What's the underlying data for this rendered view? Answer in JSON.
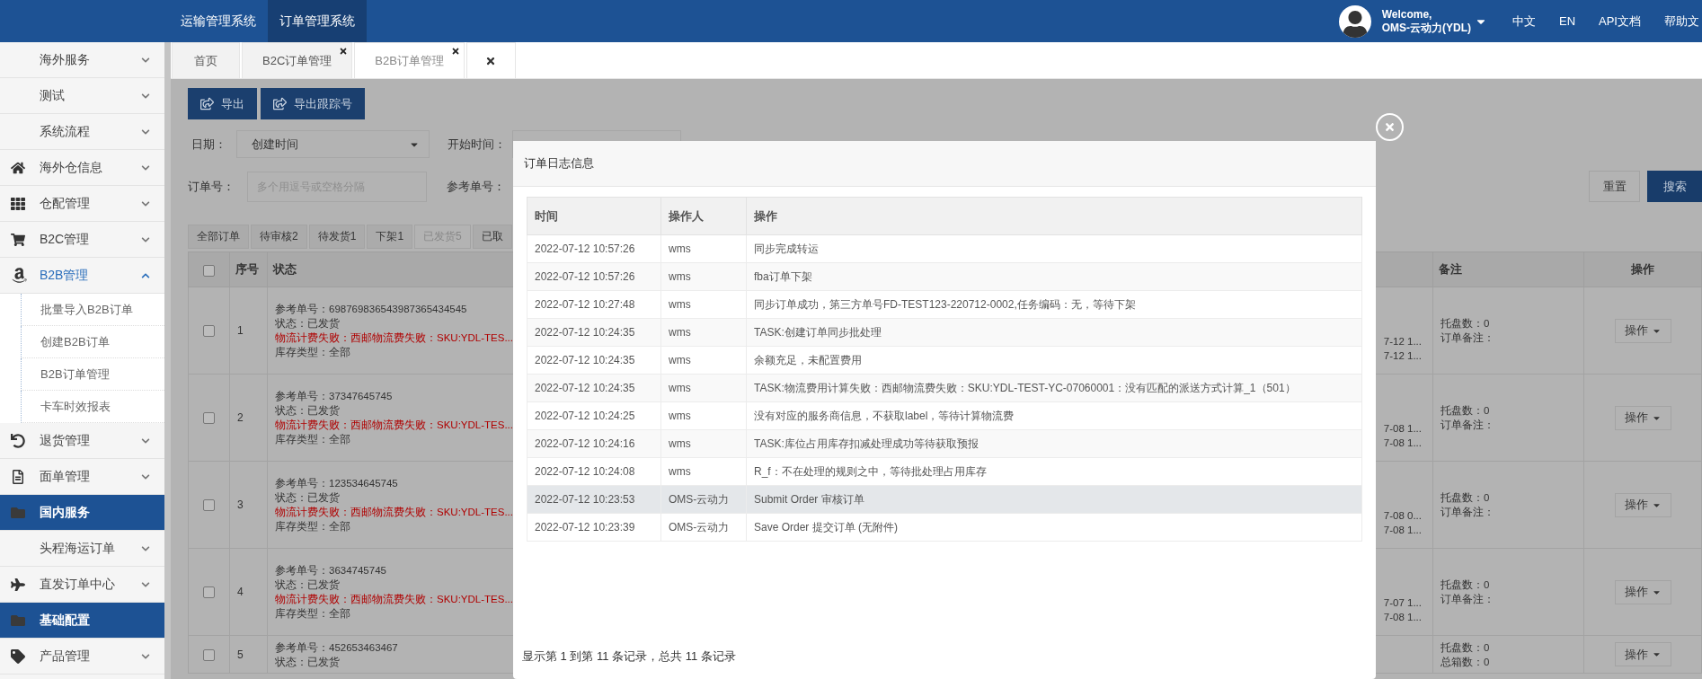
{
  "top_bar": {
    "systems": [
      {
        "label": "运输管理系统",
        "selected": false
      },
      {
        "label": "订单管理系统",
        "selected": true
      }
    ],
    "user": {
      "greeting": "Welcome,",
      "name": "OMS-云动力(YDL)"
    },
    "links": [
      "中文",
      "EN",
      "API文档",
      "帮助文"
    ]
  },
  "sidebar": {
    "items": [
      {
        "label": "海外服务",
        "kind": "menu",
        "expanded": false
      },
      {
        "label": "测试",
        "kind": "menu",
        "expanded": false
      },
      {
        "label": "系统流程",
        "kind": "menu",
        "expanded": false
      },
      {
        "label": "海外仓信息",
        "kind": "menu",
        "expanded": false
      },
      {
        "label": "仓配管理",
        "kind": "menu",
        "expanded": false
      },
      {
        "label": "B2C管理",
        "kind": "menu",
        "expanded": false
      },
      {
        "label": "B2B管理",
        "kind": "menu",
        "expanded": true,
        "children": [
          {
            "label": "批量导入B2B订单"
          },
          {
            "label": "创建B2B订单"
          },
          {
            "label": "B2B订单管理"
          },
          {
            "label": "卡车时效报表"
          }
        ]
      },
      {
        "label": "退货管理",
        "kind": "menu",
        "expanded": false
      },
      {
        "label": "面单管理",
        "kind": "menu",
        "expanded": false
      },
      {
        "label": "国内服务",
        "kind": "group"
      },
      {
        "label": "头程海运订单",
        "kind": "menu",
        "expanded": false
      },
      {
        "label": "直发订单中心",
        "kind": "menu",
        "expanded": false
      },
      {
        "label": "基础配置",
        "kind": "group"
      },
      {
        "label": "产品管理",
        "kind": "menu",
        "expanded": false
      }
    ]
  },
  "page_tabs": {
    "tabs": [
      {
        "label": "首页",
        "closable": false,
        "selected": false
      },
      {
        "label": "B2C订单管理",
        "closable": true,
        "selected": false
      },
      {
        "label": "B2B订单管理",
        "closable": true,
        "selected": true
      }
    ],
    "close_all": true
  },
  "toolbar": {
    "buttons": [
      "导出",
      "导出跟踪号"
    ]
  },
  "filters": {
    "date_label": "日期：",
    "date_value": "创建时间",
    "start_label": "开始时间：",
    "order_label": "订单号：",
    "order_placeholder": "多个用逗号或空格分隔",
    "ref_label": "参考单号：",
    "actions": [
      {
        "label": "重置",
        "primary": false
      },
      {
        "label": "搜索",
        "primary": true
      }
    ]
  },
  "status_tabs": [
    {
      "label": "全部订单",
      "selected": false
    },
    {
      "label": "待审核2",
      "selected": false
    },
    {
      "label": "待发货1",
      "selected": false
    },
    {
      "label": "下架1",
      "selected": false
    },
    {
      "label": "已发货5",
      "selected": true
    },
    {
      "label": "已取",
      "selected": false
    }
  ],
  "orders": {
    "all_checked": false,
    "columns": {
      "index": "序号",
      "status": "状态",
      "remarks": "备注",
      "actions": "操作"
    },
    "rows": [
      {
        "checked": false,
        "index": "1",
        "lines": [
          {
            "kind": "info",
            "text": "参考单号：698769836543987365434545"
          },
          {
            "kind": "info",
            "text": "状态：已发货"
          },
          {
            "kind": "error",
            "text": "物流计费失败：西邮物流费失败：SKU:YDL-TES..."
          },
          {
            "kind": "info",
            "text": "库存类型：全部"
          }
        ],
        "column_4": [
          "7-12 1...",
          "7-12 1..."
        ],
        "remarks": [
          "托盘数：0",
          "订单备注："
        ],
        "action": "操作"
      },
      {
        "checked": false,
        "index": "2",
        "lines": [
          {
            "kind": "info",
            "text": "参考单号：37347645745"
          },
          {
            "kind": "info",
            "text": "状态：已发货"
          },
          {
            "kind": "error",
            "text": "物流计费失败：西邮物流费失败：SKU:YDL-TES..."
          },
          {
            "kind": "info",
            "text": "库存类型：全部"
          }
        ],
        "column_4": [
          "7-08 1...",
          "7-08 1..."
        ],
        "remarks": [
          "托盘数：0",
          "订单备注："
        ],
        "action": "操作"
      },
      {
        "checked": false,
        "index": "3",
        "lines": [
          {
            "kind": "info",
            "text": "参考单号：123534645745"
          },
          {
            "kind": "info",
            "text": "状态：已发货"
          },
          {
            "kind": "error",
            "text": "物流计费失败：西邮物流费失败：SKU:YDL-TES..."
          },
          {
            "kind": "info",
            "text": "库存类型：全部"
          }
        ],
        "column_4": [
          "7-08 0...",
          "7-08 1..."
        ],
        "remarks": [
          "托盘数：0",
          "订单备注："
        ],
        "action": "操作"
      },
      {
        "checked": false,
        "index": "4",
        "lines": [
          {
            "kind": "info",
            "text": "参考单号：3634745745"
          },
          {
            "kind": "info",
            "text": "状态：已发货"
          },
          {
            "kind": "error",
            "text": "物流计费失败：西邮物流费失败：SKU:YDL-TES..."
          },
          {
            "kind": "info",
            "text": "库存类型：全部"
          }
        ],
        "column_4": [
          "7-07 1...",
          "7-08 1..."
        ],
        "remarks": [
          "托盘数：0",
          "订单备注："
        ],
        "action": "操作"
      },
      {
        "checked": false,
        "index": "5",
        "lines": [
          {
            "kind": "info",
            "text": "参考单号：452653463467"
          },
          {
            "kind": "info",
            "text": "状态：已发货"
          }
        ],
        "column_4": [],
        "remarks": [
          "托盘数：0",
          "总箱数：0"
        ],
        "action": "操作"
      }
    ]
  },
  "log_dialog": {
    "title": "订单日志信息",
    "columns": [
      "时间",
      "操作人",
      "操作"
    ],
    "rows": [
      {
        "time": "2022-07-12 10:57:26",
        "operator": "wms",
        "action": "同步完成转运",
        "selected": false
      },
      {
        "time": "2022-07-12 10:57:26",
        "operator": "wms",
        "action": "fba订单下架",
        "selected": false
      },
      {
        "time": "2022-07-12 10:27:48",
        "operator": "wms",
        "action": "同步订单成功，第三方单号FD-TEST123-220712-0002,任务编码：无，等待下架",
        "selected": false
      },
      {
        "time": "2022-07-12 10:24:35",
        "operator": "wms",
        "action": "TASK:创建订单同步批处理",
        "selected": false
      },
      {
        "time": "2022-07-12 10:24:35",
        "operator": "wms",
        "action": "余额充足，未配置费用",
        "selected": false
      },
      {
        "time": "2022-07-12 10:24:35",
        "operator": "wms",
        "action": "TASK:物流费用计算失败：西邮物流费失败：SKU:YDL-TEST-YC-07060001：没有匹配的派送方式计算_1（501）",
        "selected": false
      },
      {
        "time": "2022-07-12 10:24:25",
        "operator": "wms",
        "action": "没有对应的服务商信息，不获取label，等待计算物流费",
        "selected": false
      },
      {
        "time": "2022-07-12 10:24:16",
        "operator": "wms",
        "action": "TASK:库位占用库存扣减处理成功等待获取预报",
        "selected": false
      },
      {
        "time": "2022-07-12 10:24:08",
        "operator": "wms",
        "action": "R_f：不在处理的规则之中，等待批处理占用库存",
        "selected": false
      },
      {
        "time": "2022-07-12 10:23:53",
        "operator": "OMS-云动力",
        "action": "Submit Order 审核订单",
        "selected": true
      },
      {
        "time": "2022-07-12 10:23:39",
        "operator": "OMS-云动力",
        "action": "Save Order 提交订单 (无附件)",
        "selected": false
      }
    ],
    "footer": "显示第 1 到第 11 条记录，总共 11 条记录"
  }
}
